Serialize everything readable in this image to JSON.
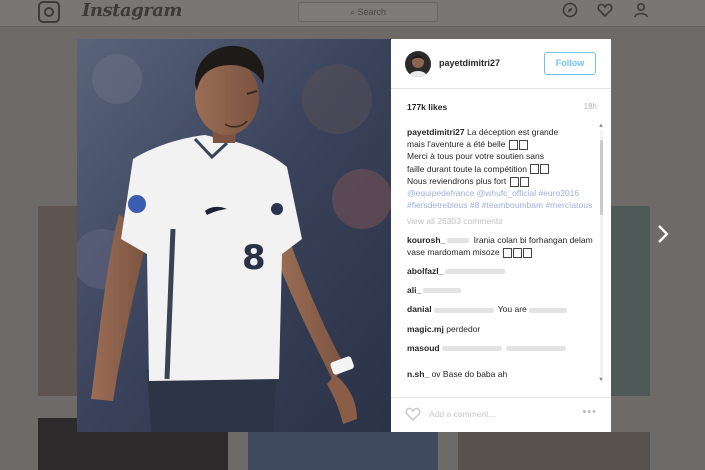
{
  "header": {
    "wordmark": "Instagram",
    "search_placeholder": "Search",
    "icons": [
      "instagram-logo-icon",
      "compass-icon",
      "heart-icon",
      "profile-icon"
    ]
  },
  "post": {
    "username": "payetdimitri27",
    "follow_label": "Follow",
    "likes": "177k likes",
    "time_ago": "18h",
    "caption_lines": [
      "La déception est grande",
      "mais l'aventure a été belle",
      "Merci à tous pour votre soutien sans",
      "faille durant toute la compétition",
      "Nous reviendrons plus fort"
    ],
    "caption_tags": "@equipedefrance @whufc_official #euro2016 #fiersdetrebleus #8 #teamboumbam #mercìatous",
    "view_all": "view all 26303 comments",
    "comments": [
      {
        "user": "kourosh_",
        "text": "Irania colan bi forhangan delam vase mardomam misoze"
      },
      {
        "user": "abolfazl_",
        "text": ""
      },
      {
        "user": "ali_",
        "text": ""
      },
      {
        "user": "danial",
        "text": "You are"
      },
      {
        "user": "magic.mj",
        "text": "perdedor"
      },
      {
        "user": "masoud",
        "text": ""
      },
      {
        "user": "n.sh_",
        "text": "ov   Base do baba ah"
      }
    ],
    "add_comment_placeholder": "Add a comment...",
    "more": "•••"
  },
  "colors": {
    "follow_blue": "#70c3f0",
    "hashtag_blue": "#9fb0d8",
    "jersey_white": "#f2f2f2",
    "dim_overlay": "#6e6a67"
  },
  "photo": {
    "jersey_number": "8"
  }
}
